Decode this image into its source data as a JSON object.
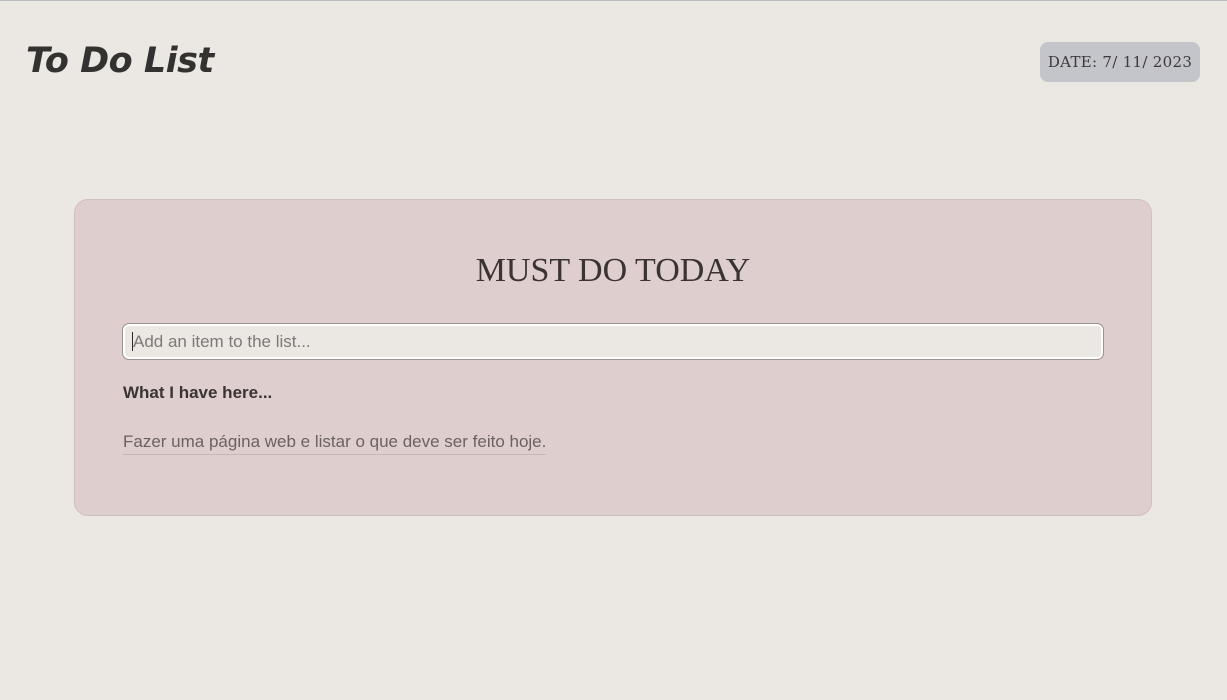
{
  "header": {
    "app_title": "To Do List",
    "date_label": "DATE: 7/ 11/ 2023"
  },
  "card": {
    "title": "MUST DO TODAY",
    "input": {
      "value": "",
      "placeholder": "Add an item to the list..."
    },
    "section_label": "What I have here...",
    "items": [
      {
        "text": "Fazer uma página web e listar o que deve ser feito hoje."
      }
    ]
  }
}
